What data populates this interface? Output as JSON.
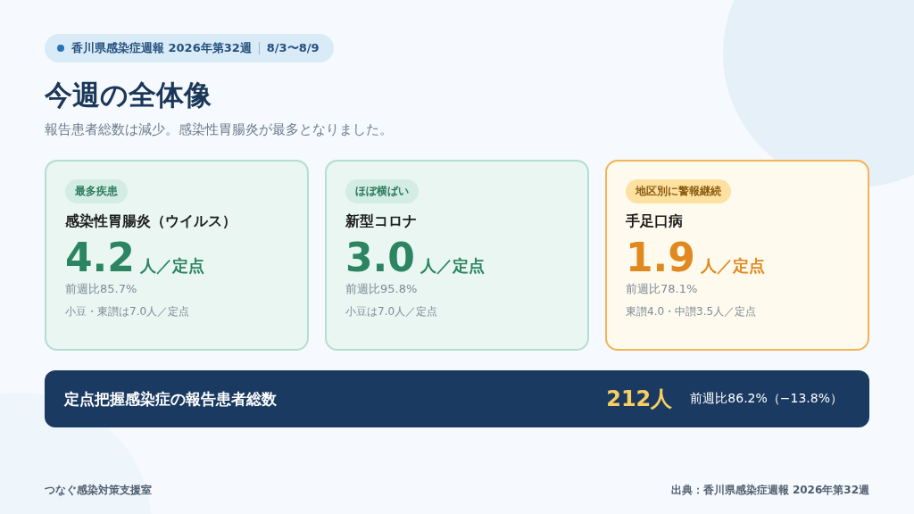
{
  "header": {
    "report": "香川県感染症週報 2026年第32週",
    "period": "8/3〜8/9"
  },
  "title": "今週の全体像",
  "subtitle": "報告患者総数は減少。感染性胃腸炎が最多となりました。",
  "cards": [
    {
      "kind": "normal",
      "badge": "最多疾患",
      "disease": "感染性胃腸炎（ウイルス）",
      "value": "4.2",
      "unit": "人／定点",
      "ratio": "前週比85.7%",
      "note": "小豆・東讃は7.0人／定点"
    },
    {
      "kind": "normal",
      "badge": "ほぼ横ばい",
      "disease": "新型コロナ",
      "value": "3.0",
      "unit": "人／定点",
      "ratio": "前週比95.8%",
      "note": "小豆は7.0人／定点"
    },
    {
      "kind": "alert",
      "badge": "地区別に警報継続",
      "disease": "手足口病",
      "value": "1.9",
      "unit": "人／定点",
      "ratio": "前週比78.1%",
      "note": "東讃4.0・中讃3.5人／定点"
    }
  ],
  "total": {
    "label": "定点把握感染症の報告患者総数",
    "value": "212人",
    "change": "前週比86.2%（−13.8%）"
  },
  "footer": {
    "left": "つなぐ感染対策支援室",
    "right": "出典：香川県感染症週報 2026年第32週"
  }
}
